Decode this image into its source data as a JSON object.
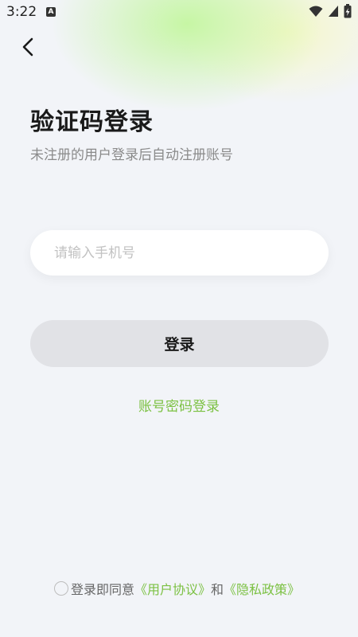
{
  "status_bar": {
    "time": "3:22",
    "app_icon_letter": "A"
  },
  "header": {
    "back_icon": "chevron-left-icon"
  },
  "login": {
    "title": "验证码登录",
    "subtitle": "未注册的用户登录后自动注册账号",
    "phone_placeholder": "请输入手机号",
    "phone_value": "",
    "login_button": "登录",
    "password_login_link": "账号密码登录"
  },
  "agreement": {
    "prefix": "登录即同意",
    "user_agreement": "《用户协议》",
    "conjunction": "和",
    "privacy_policy": "《隐私政策》",
    "checked": false
  },
  "colors": {
    "accent_green": "#7cc143",
    "background": "#f2f4f8",
    "button_bg": "#e1e2e6"
  }
}
